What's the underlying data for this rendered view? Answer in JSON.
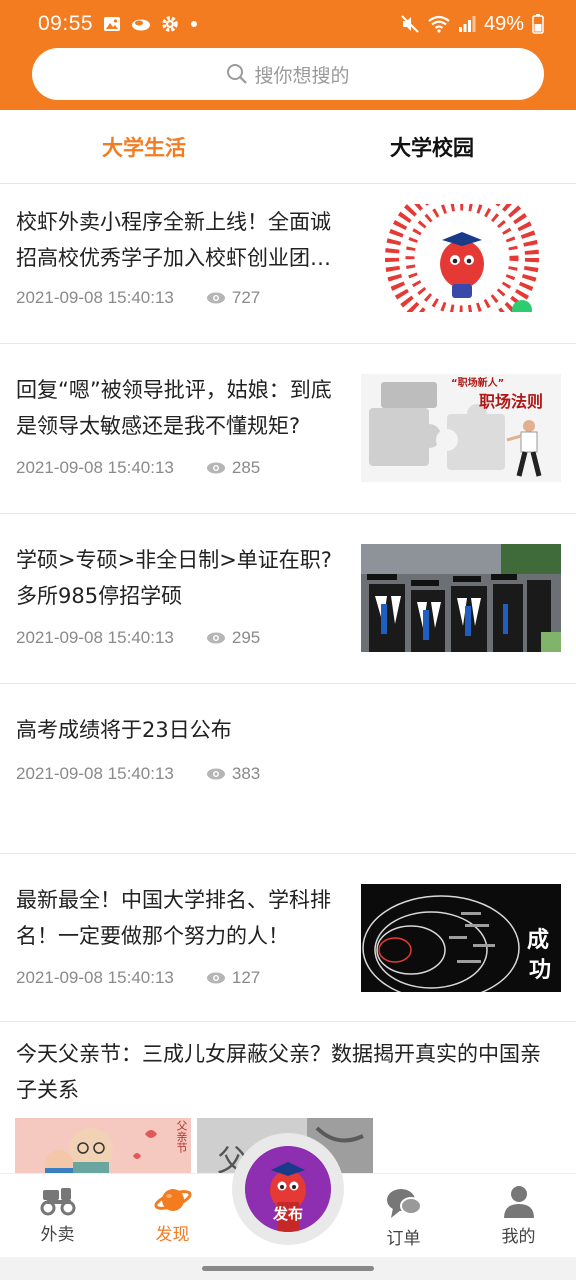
{
  "status_bar": {
    "time": "09:55",
    "battery": "49%",
    "left_icons": [
      "image-icon",
      "cloud-icon",
      "gear-icon",
      "dot-icon"
    ],
    "right_icons": [
      "mute-icon",
      "wifi-icon",
      "signal-icon",
      "battery-icon"
    ]
  },
  "search": {
    "placeholder": "搜你想搜的",
    "icon": "search-icon"
  },
  "tabs": [
    {
      "label": "大学生活",
      "active": true
    },
    {
      "label": "大学校园",
      "active": false
    }
  ],
  "feed": [
    {
      "title": "校虾外卖小程序全新上线！全面诚招高校优秀学子加入校虾创业团…",
      "date": "2021-09-08 15:40:13",
      "views": "727",
      "thumb": "qr-mascot"
    },
    {
      "title": "回复“嗯”被领导批评，姑娘：到底是领导太敏感还是我不懂规矩?",
      "date": "2021-09-08 15:40:13",
      "views": "285",
      "thumb": "puzzle-workplace",
      "thumb_text_1": "“职场新人”",
      "thumb_text_2": "职场法则"
    },
    {
      "title": "学硕>专硕>非全日制>单证在职?多所985停招学硕",
      "date": "2021-09-08 15:40:13",
      "views": "295",
      "thumb": "graduation-crowd"
    },
    {
      "title": "高考成绩将于23日公布",
      "date": "2021-09-08 15:40:13",
      "views": "383",
      "thumb": ""
    },
    {
      "title": "最新最全！中国大学排名、学科排名！一定要做那个努力的人！",
      "date": "2021-09-08 15:40:13",
      "views": "127",
      "thumb": "success-circles",
      "thumb_text_1": "成",
      "thumb_text_2": "功"
    },
    {
      "title": "今天父亲节：三成儿女屏蔽父亲？数据揭开真实的中国亲子关系",
      "thumb": "fathers-day-images",
      "thumb_text_1": "父亲节",
      "thumb_text_2": "父"
    }
  ],
  "bottom_nav": [
    {
      "label": "外卖",
      "icon": "scooter-icon",
      "active": false
    },
    {
      "label": "发现",
      "icon": "planet-icon",
      "active": true
    },
    {
      "label": "发布",
      "icon": "mascot-icon",
      "center": true
    },
    {
      "label": "订单",
      "icon": "chat-bubbles-icon",
      "active": false
    },
    {
      "label": "我的",
      "icon": "user-icon",
      "active": false
    }
  ],
  "colors": {
    "accent": "#f47c20",
    "publish": "#8d2fb0"
  }
}
